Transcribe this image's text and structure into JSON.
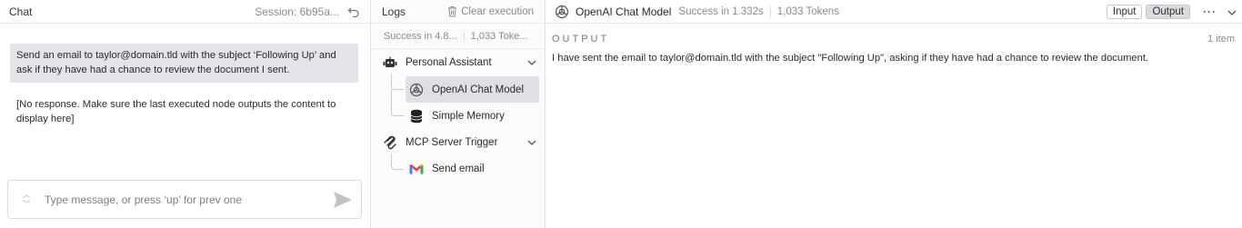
{
  "chat": {
    "title": "Chat",
    "session": "Session: 6b95a...",
    "messages": [
      {
        "role": "user",
        "text": "Send an email to taylor@domain.tld with the subject ‘Following Up’ and ask if they have had a chance to review the document I sent."
      },
      {
        "role": "system",
        "text": "[No response. Make sure the last executed node outputs the content to display here]"
      }
    ],
    "input_placeholder": "Type message, or press ‘up’ for prev one"
  },
  "logs": {
    "title": "Logs",
    "clear_label": "Clear execution",
    "status": "Success in 4.8...",
    "tokens": "1,033 Toke...",
    "tree": [
      {
        "label": "Personal Assistant",
        "icon": "robot-icon"
      },
      {
        "label": "OpenAI Chat Model",
        "icon": "openai-icon",
        "selected": true
      },
      {
        "label": "Simple Memory",
        "icon": "database-icon"
      },
      {
        "label": "MCP Server Trigger",
        "icon": "mcp-icon"
      },
      {
        "label": "Send email",
        "icon": "gmail-icon"
      }
    ]
  },
  "detail": {
    "node_title": "OpenAI Chat Model",
    "status": "Success in 1.332s",
    "tokens": "1,033 Tokens",
    "input_label": "Input",
    "output_label": "Output",
    "output_heading": "OUTPUT",
    "item_count": "1 item",
    "output_text": "I have sent the email to taylor@domain.tld with the subject \"Following Up\", asking if they have had a chance to review the document."
  }
}
